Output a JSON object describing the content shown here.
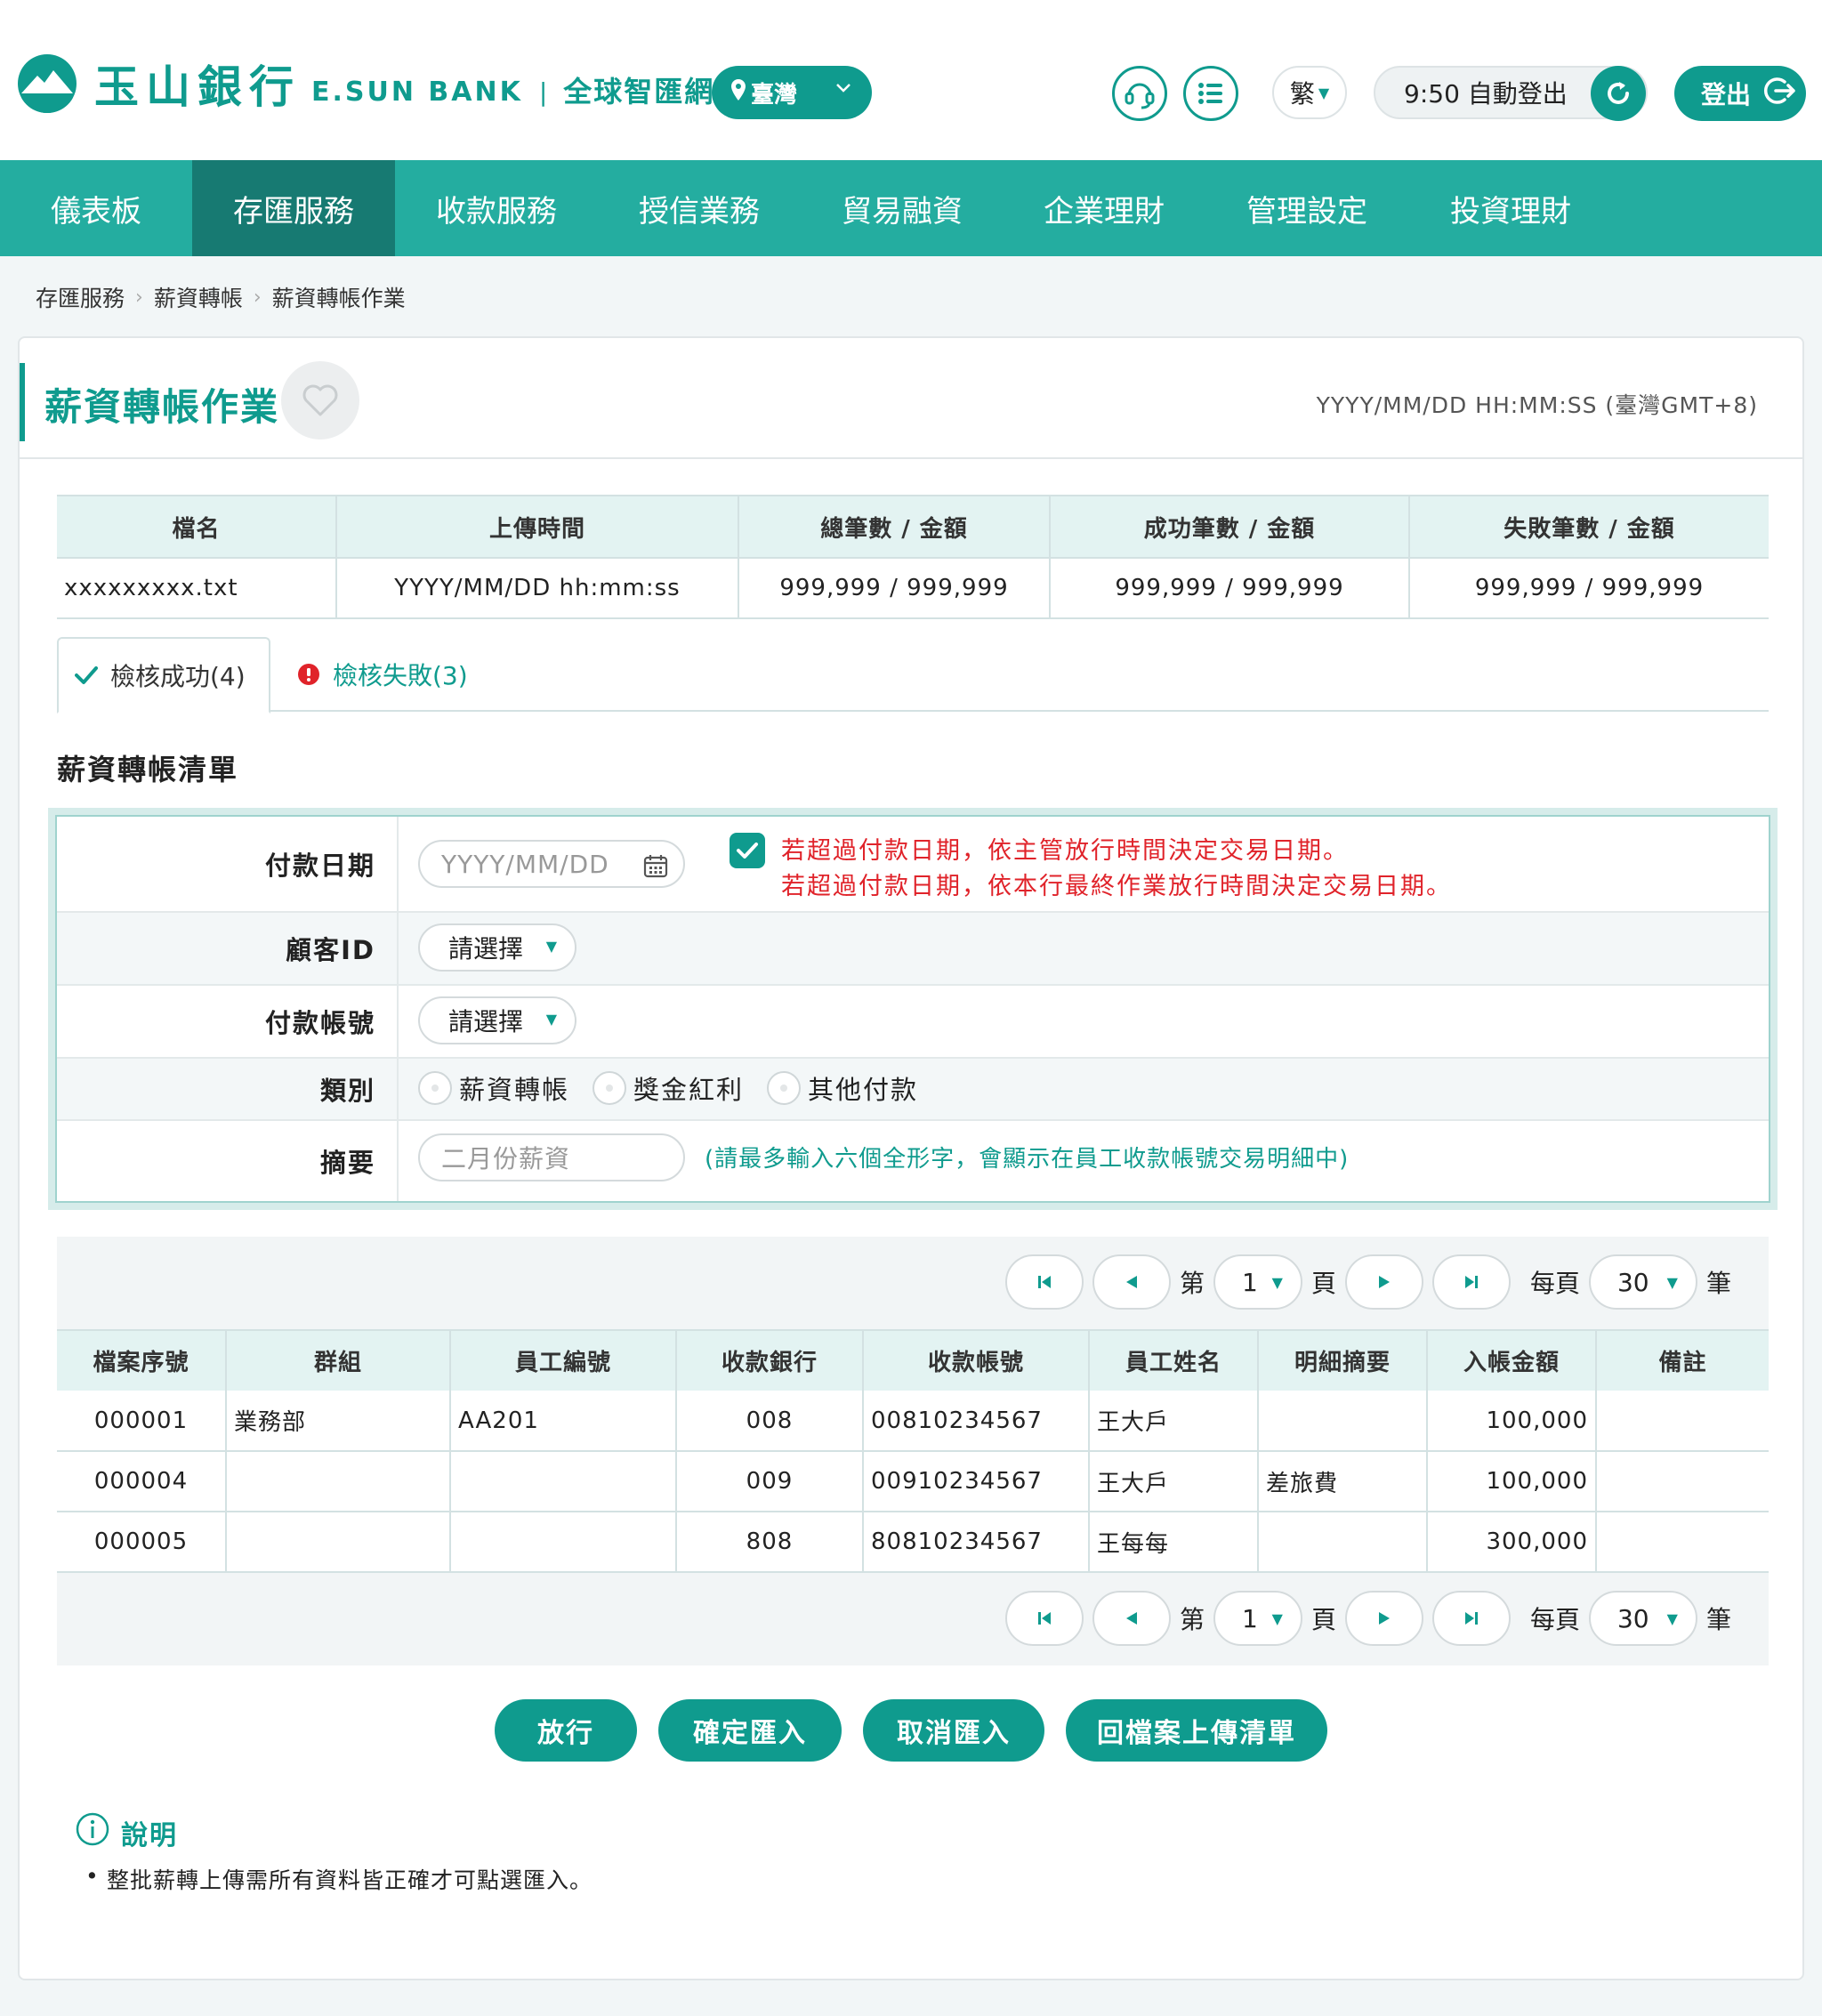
{
  "header": {
    "bank_name_cn": "玉山銀行",
    "bank_name_en": "E.SUN BANK",
    "separator": "|",
    "portal_name": "全球智匯網",
    "region": "臺灣",
    "language": "繁",
    "session": "9:50 自動登出",
    "logout": "登出"
  },
  "nav": {
    "items": [
      "儀表板",
      "存匯服務",
      "收款服務",
      "授信業務",
      "貿易融資",
      "企業理財",
      "管理設定",
      "投資理財"
    ],
    "active": "存匯服務"
  },
  "breadcrumb": [
    "存匯服務",
    "薪資轉帳",
    "薪資轉帳作業"
  ],
  "page": {
    "title": "薪資轉帳作業",
    "server_time": "YYYY/MM/DD HH:MM:SS (臺灣GMT+8)"
  },
  "summary": {
    "headers": [
      "檔名",
      "上傳時間",
      "總筆數 / 金額",
      "成功筆數 / 金額",
      "失敗筆數 / 金額"
    ],
    "row": [
      "xxxxxxxxx.txt",
      "YYYY/MM/DD hh:mm:ss",
      "999,999 / 999,999",
      "999,999 / 999,999",
      "999,999 / 999,999"
    ]
  },
  "tabs": {
    "success": "檢核成功(4)",
    "failure": "檢核失敗(3)"
  },
  "list_title": "薪資轉帳清單",
  "form": {
    "pay_date_label": "付款日期",
    "pay_date_placeholder": "YYYY/MM/DD",
    "warning_line1": "若超過付款日期，依主管放行時間決定交易日期。",
    "warning_line2": "若超過付款日期，依本行最終作業放行時間決定交易日期。",
    "customer_id_label": "顧客ID",
    "customer_id_value": "請選擇",
    "account_label": "付款帳號",
    "account_value": "請選擇",
    "type_label": "類別",
    "type_options": [
      "薪資轉帳",
      "獎金紅利",
      "其他付款"
    ],
    "memo_label": "摘要",
    "memo_placeholder": "二月份薪資",
    "memo_hint": "(請最多輸入六個全形字，會顯示在員工收款帳號交易明細中)"
  },
  "pager": {
    "page_prefix": "第",
    "page_value": "1",
    "page_suffix": "頁",
    "per_page_prefix": "每頁",
    "per_page_value": "30",
    "per_page_suffix": "筆"
  },
  "detail": {
    "headers": [
      "檔案序號",
      "群組",
      "員工編號",
      "收款銀行",
      "收款帳號",
      "員工姓名",
      "明細摘要",
      "入帳金額",
      "備註"
    ],
    "rows": [
      [
        "000001",
        "業務部",
        "AA201",
        "008",
        "00810234567",
        "王大戶",
        "",
        "100,000",
        ""
      ],
      [
        "000004",
        "",
        "",
        "009",
        "00910234567",
        "王大戶",
        "差旅費",
        "100,000",
        ""
      ],
      [
        "000005",
        "",
        "",
        "808",
        "80810234567",
        "王每每",
        "",
        "300,000",
        ""
      ]
    ]
  },
  "actions": [
    "放行",
    "確定匯入",
    "取消匯入",
    "回檔案上傳清單"
  ],
  "notes": {
    "title": "說明",
    "items": [
      "整批薪轉上傳需所有資料皆正確才可點選匯入。"
    ]
  },
  "colors": {
    "brand": "#0f9b8e",
    "nav_bg": "#24ada0",
    "nav_active": "#177a72",
    "warning": "#e0232a"
  }
}
